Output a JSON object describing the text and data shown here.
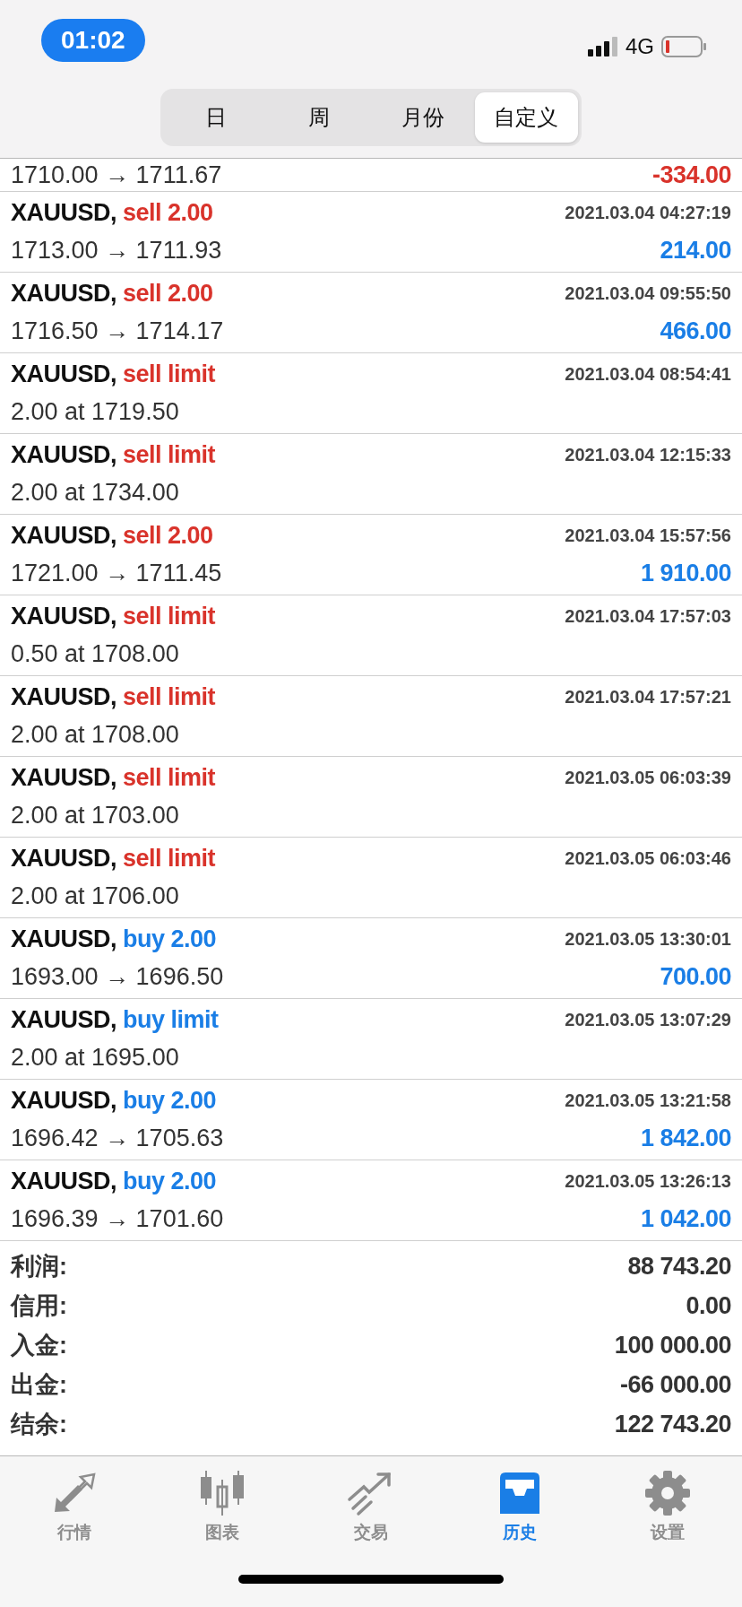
{
  "status_bar": {
    "time": "01:02",
    "network": "4G"
  },
  "period_tabs": [
    {
      "label": "日",
      "selected": false
    },
    {
      "label": "周",
      "selected": false
    },
    {
      "label": "月份",
      "selected": false
    },
    {
      "label": "自定义",
      "selected": true
    }
  ],
  "orders": [
    {
      "detail": "1710.00 → 1711.67",
      "profit": "-334.00",
      "loss": true
    },
    {
      "symbol": "XAUUSD,",
      "action": "sell 2.00",
      "color": "#d9332b",
      "time": "2021.03.04 04:27:19",
      "detail": "1713.00 → 1711.93",
      "profit": "214.00",
      "loss": false
    },
    {
      "symbol": "XAUUSD,",
      "action": "sell 2.00",
      "color": "#d9332b",
      "time": "2021.03.04 09:55:50",
      "detail": "1716.50 → 1714.17",
      "profit": "466.00",
      "loss": false
    },
    {
      "symbol": "XAUUSD,",
      "action": "sell limit",
      "color": "#d9332b",
      "time": "2021.03.04 08:54:41",
      "detail": "2.00 at 1719.50"
    },
    {
      "symbol": "XAUUSD,",
      "action": "sell limit",
      "color": "#d9332b",
      "time": "2021.03.04 12:15:33",
      "detail": "2.00 at 1734.00"
    },
    {
      "symbol": "XAUUSD,",
      "action": "sell 2.00",
      "color": "#d9332b",
      "time": "2021.03.04 15:57:56",
      "detail": "1721.00 → 1711.45",
      "profit": "1 910.00",
      "loss": false
    },
    {
      "symbol": "XAUUSD,",
      "action": "sell limit",
      "color": "#d9332b",
      "time": "2021.03.04 17:57:03",
      "detail": "0.50 at 1708.00"
    },
    {
      "symbol": "XAUUSD,",
      "action": "sell limit",
      "color": "#d9332b",
      "time": "2021.03.04 17:57:21",
      "detail": "2.00 at 1708.00"
    },
    {
      "symbol": "XAUUSD,",
      "action": "sell limit",
      "color": "#d9332b",
      "time": "2021.03.05 06:03:39",
      "detail": "2.00 at 1703.00"
    },
    {
      "symbol": "XAUUSD,",
      "action": "sell limit",
      "color": "#d9332b",
      "time": "2021.03.05 06:03:46",
      "detail": "2.00 at 1706.00"
    },
    {
      "symbol": "XAUUSD,",
      "action": "buy 2.00",
      "color": "#1a7ee6",
      "time": "2021.03.05 13:30:01",
      "detail": "1693.00 → 1696.50",
      "profit": "700.00",
      "loss": false
    },
    {
      "symbol": "XAUUSD,",
      "action": "buy limit",
      "color": "#1a7ee6",
      "time": "2021.03.05 13:07:29",
      "detail": "2.00 at 1695.00"
    },
    {
      "symbol": "XAUUSD,",
      "action": "buy 2.00",
      "color": "#1a7ee6",
      "time": "2021.03.05 13:21:58",
      "detail": "1696.42 → 1705.63",
      "profit": "1 842.00",
      "loss": false
    },
    {
      "symbol": "XAUUSD,",
      "action": "buy 2.00",
      "color": "#1a7ee6",
      "time": "2021.03.05 13:26:13",
      "detail": "1696.39 → 1701.60",
      "profit": "1 042.00",
      "loss": false
    }
  ],
  "summary": [
    {
      "label": "利润:",
      "value": "88 743.20"
    },
    {
      "label": "信用:",
      "value": "0.00"
    },
    {
      "label": "入金:",
      "value": "100 000.00"
    },
    {
      "label": "出金:",
      "value": "-66 000.00"
    },
    {
      "label": "结余:",
      "value": "122 743.20"
    }
  ],
  "tab_bar": [
    {
      "kind": "quotes",
      "label": "行情",
      "selected": false
    },
    {
      "kind": "chart",
      "label": "图表",
      "selected": false
    },
    {
      "kind": "trade",
      "label": "交易",
      "selected": false
    },
    {
      "kind": "history",
      "label": "历史",
      "selected": true
    },
    {
      "kind": "settings",
      "label": "设置",
      "selected": false
    }
  ]
}
